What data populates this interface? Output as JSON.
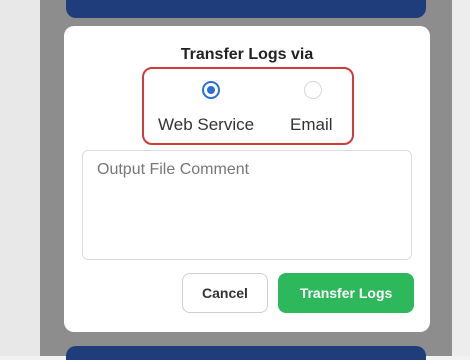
{
  "dialog": {
    "title": "Transfer Logs via",
    "options": [
      {
        "label": "Web Service",
        "selected": true
      },
      {
        "label": "Email",
        "selected": false
      }
    ],
    "comment": {
      "placeholder": "Output File Comment",
      "value": ""
    },
    "buttons": {
      "cancel": "Cancel",
      "transfer": "Transfer Logs"
    }
  },
  "colors": {
    "accent_blue": "#2a6fd6",
    "highlight_red": "#d23a3a",
    "primary_green": "#2eb85c",
    "nav_bar": "#1f3d7a"
  }
}
